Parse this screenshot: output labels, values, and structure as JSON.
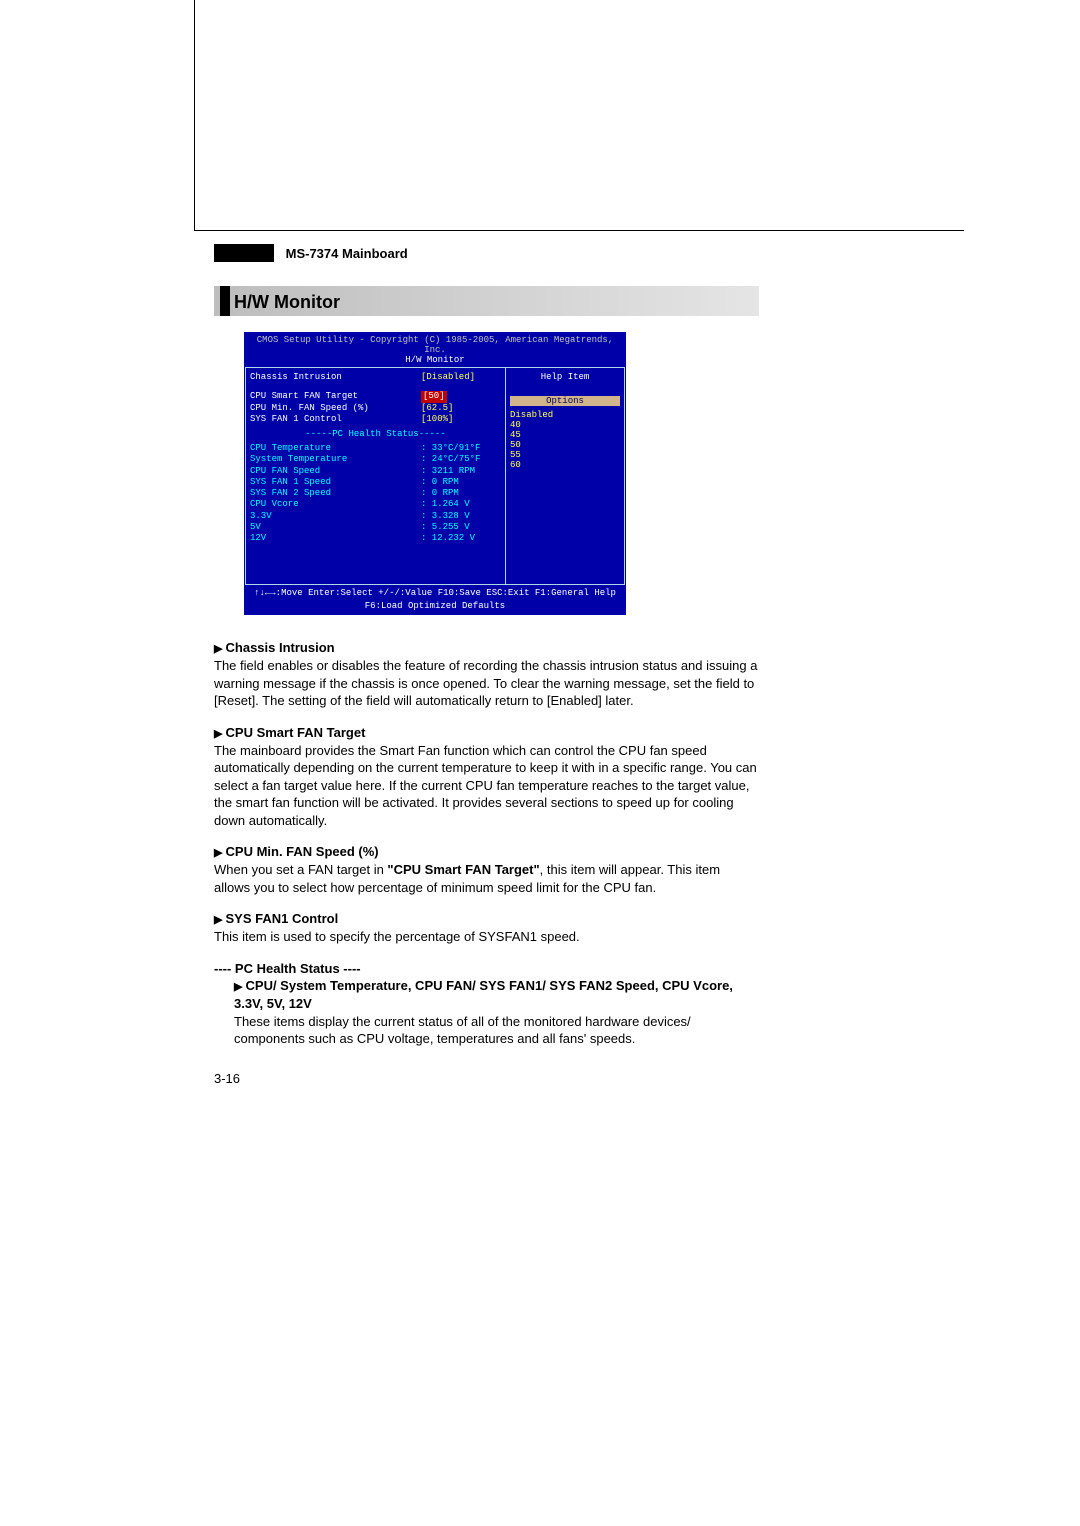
{
  "header": {
    "mainboard": "MS-7374 Mainboard",
    "section": "H/W Monitor"
  },
  "bios": {
    "copyright": "CMOS Setup Utility - Copyright (C) 1985-2005, American Megatrends, Inc.",
    "screen": "H/W Monitor",
    "settings": [
      {
        "label": "Chassis Intrusion",
        "value": "[Disabled]",
        "style": "white"
      }
    ],
    "fan_settings": [
      {
        "label": "CPU Smart FAN Target",
        "value": "[50]",
        "selected": true
      },
      {
        "label": "CPU Min. FAN Speed (%)",
        "value": "[62.5]"
      },
      {
        "label": "SYS FAN 1 Control",
        "value": "[100%]"
      }
    ],
    "health_divider": "-----PC Health Status-----",
    "health": [
      {
        "label": "CPU Temperature",
        "value": ": 33°C/91°F"
      },
      {
        "label": "System Temperature",
        "value": ": 24°C/75°F"
      },
      {
        "label": "CPU FAN Speed",
        "value": ": 3211 RPM"
      },
      {
        "label": "SYS FAN 1 Speed",
        "value": ": 0 RPM"
      },
      {
        "label": "SYS FAN 2 Speed",
        "value": ": 0 RPM"
      },
      {
        "label": "CPU Vcore",
        "value": ": 1.264 V"
      },
      {
        "label": "3.3V",
        "value": ": 3.328 V"
      },
      {
        "label": "5V",
        "value": ": 5.255 V"
      },
      {
        "label": "12V",
        "value": ": 12.232 V"
      }
    ],
    "help": {
      "title": "Help Item",
      "options_label": "Options",
      "options": [
        "Disabled",
        "40",
        "45",
        "50",
        "55",
        "60"
      ]
    },
    "footer1": "↑↓←→:Move   Enter:Select  +/-/:Value  F10:Save  ESC:Exit  F1:General Help",
    "footer2": "F6:Load Optimized Defaults"
  },
  "descriptions": {
    "chassis_title": "Chassis Intrusion",
    "chassis_body": "The field enables or disables the feature of recording the chassis intrusion status and issuing a warning message if the chassis is once opened. To clear the warning message, set the field to [Reset]. The setting of the field will automatically return to [Enabled] later.",
    "smartfan_title": "CPU Smart FAN Target",
    "smartfan_body": "The mainboard provides the Smart Fan function which can control the CPU fan speed automatically depending on the current temperature to keep it with in a specific range. You can select a fan target value here. If the current CPU fan temperature reaches to the target value, the smart fan function will be activated. It provides several sections to speed up for cooling down automatically.",
    "cpumin_title": "CPU Min. FAN Speed (%)",
    "cpumin_body_1": "When you set a FAN target in ",
    "cpumin_body_bold": "\"CPU Smart FAN Target\"",
    "cpumin_body_2": ", this item will appear. This item allows you to select how percentage of minimum speed limit for the CPU fan.",
    "sysfan_title": "SYS FAN1 Control",
    "sysfan_body": "This item is used to specify the percentage of SYSFAN1 speed.",
    "pchealth_title": "---- PC Health Status ----",
    "pchealth_sub_title": "CPU/ System Temperature, CPU FAN/ SYS FAN1/ SYS FAN2 Speed, CPU Vcore, 3.3V, 5V, 12V",
    "pchealth_sub_body": "These items display the current status of all of the monitored hardware devices/ components such as CPU voltage, temperatures and all fans' speeds."
  },
  "page_number": "3-16"
}
